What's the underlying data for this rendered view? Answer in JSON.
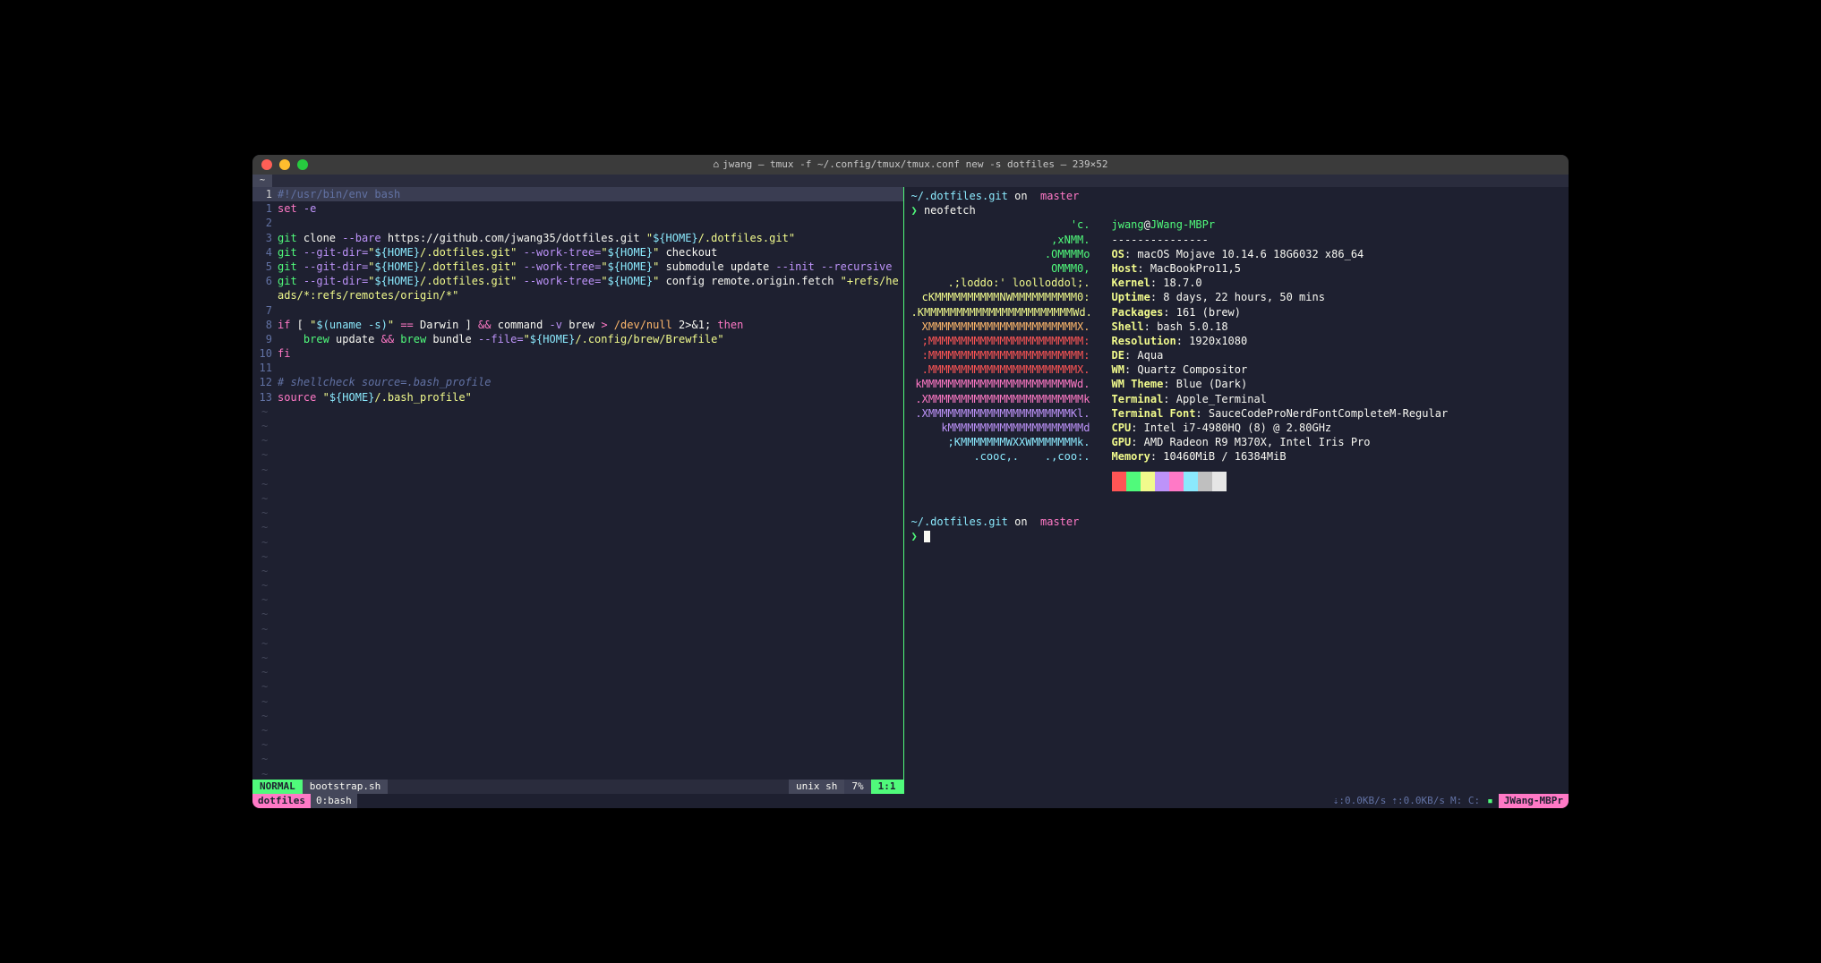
{
  "titlebar": {
    "title": "jwang — tmux -f ~/.config/tmux/tmux.conf new -s dotfiles — 239×52"
  },
  "tabbar": {
    "tab": "~"
  },
  "editor": {
    "filename": "bootstrap.sh",
    "mode": "NORMAL",
    "filetype_left": " unix",
    "filetype_right": " sh",
    "percent": "7%",
    "position": "1:1",
    "lines": {
      "l0_num": "1",
      "l0": "#!/usr/bin/env bash",
      "l1_num": "1",
      "l1_set": "set",
      "l1_flag": " -e",
      "l2_num": "2",
      "l3_num": "3",
      "l3_cmd": "git",
      "l3_rest1": " clone ",
      "l3_flag1": "--bare",
      "l3_url": " https://github.com/jwang35/dotfiles.git ",
      "l3_q": "\"",
      "l3_var": "${HOME}",
      "l3_path": "/.dotfiles.git",
      "l3_q2": "\"",
      "l4_num": "4",
      "l4_cmd": "git",
      "l4_sp": " ",
      "l4_flag1": "--git-dir=",
      "l4_q1": "\"",
      "l4_var1": "${HOME}",
      "l4_p1": "/.dotfiles.git",
      "l4_q2": "\"",
      "l4_sp2": " ",
      "l4_flag2": "--work-tree=",
      "l4_q3": "\"",
      "l4_var2": "${HOME}",
      "l4_q4": "\"",
      "l4_rest": " checkout",
      "l5_num": "5",
      "l5_cmd": "git",
      "l5_sp": " ",
      "l5_flag1": "--git-dir=",
      "l5_q1": "\"",
      "l5_var1": "${HOME}",
      "l5_p1": "/.dotfiles.git",
      "l5_q2": "\"",
      "l5_sp2": " ",
      "l5_flag2": "--work-tree=",
      "l5_q3": "\"",
      "l5_var2": "${HOME}",
      "l5_q4": "\"",
      "l5_rest": " submodule update ",
      "l5_flag3": "--init --recursive",
      "l6_num": "6",
      "l6_cmd": "git",
      "l6_sp": " ",
      "l6_flag1": "--git-dir=",
      "l6_q1": "\"",
      "l6_var1": "${HOME}",
      "l6_p1": "/.dotfiles.git",
      "l6_q2": "\"",
      "l6_sp2": " ",
      "l6_flag2": "--work-tree=",
      "l6_q3": "\"",
      "l6_var2": "${HOME}",
      "l6_q4": "\"",
      "l6_rest": " config remote.origin.fetch ",
      "l6_q5": "\"",
      "l6_str": "+refs/heads/*:refs/remotes/origin/*",
      "l6_q6": "\"",
      "l7_num": "7",
      "l8_num": "8",
      "l8_kw1": "if",
      "l8_br1": " [ ",
      "l8_q1": "\"",
      "l8_sub": "$(uname -s)",
      "l8_q2": "\"",
      "l8_eq": " == ",
      "l8_darwin": "Darwin",
      "l8_br2": " ] ",
      "l8_and": "&&",
      "l8_cmd": " command ",
      "l8_flag": "-v",
      "l8_brew": " brew ",
      "l8_op": "> ",
      "l8_dev": "/dev/null",
      "l8_redir": " 2>&1; ",
      "l8_then": "then",
      "l9_num": "9",
      "l9_indent": "    ",
      "l9_cmd1": "brew",
      "l9_up": " update ",
      "l9_and": "&&",
      "l9_cmd2": " brew",
      "l9_bundle": " bundle ",
      "l9_flag": "--file=",
      "l9_q1": "\"",
      "l9_var": "${HOME}",
      "l9_path": "/.config/brew/Brewfile",
      "l9_q2": "\"",
      "l10_num": "10",
      "l10_fi": "fi",
      "l11_num": "11",
      "l12_num": "12",
      "l12_comment": "# shellcheck source=.bash_profile",
      "l13_num": "13",
      "l13_cmd": "source",
      "l13_sp": " ",
      "l13_q1": "\"",
      "l13_var": "${HOME}",
      "l13_path": "/.bash_profile",
      "l13_q2": "\""
    },
    "tilde": "~"
  },
  "prompt": {
    "path": "~/.dotfiles.git",
    "on": " on ",
    "branch_icon": "",
    "branch": " master",
    "symbol": "❯",
    "command": " neofetch"
  },
  "neofetch": {
    "art": [
      "'c.",
      ",xNMM.",
      ".OMMMMo",
      "OMMM0,",
      ".;loddo:' loolloddol;.",
      "cKMMMMMMMMMMNWMMMMMMMMMM0:",
      ".KMMMMMMMMMMMMMMMMMMMMMMMWd.",
      "XMMMMMMMMMMMMMMMMMMMMMMMX.",
      ";MMMMMMMMMMMMMMMMMMMMMMMM:",
      ":MMMMMMMMMMMMMMMMMMMMMMMM:",
      ".MMMMMMMMMMMMMMMMMMMMMMMX.",
      "kMMMMMMMMMMMMMMMMMMMMMMMWd.",
      ".XMMMMMMMMMMMMMMMMMMMMMMMMk",
      ".XMMMMMMMMMMMMMMMMMMMMMMKl.",
      "kMMMMMMMMMMMMMMMMMMMMMd",
      ";KMMMMMMMWXXWMMMMMMMk.",
      ".cooc,.    .,coo:."
    ],
    "art_colors": [
      "#50fa7b",
      "#50fa7b",
      "#50fa7b",
      "#50fa7b",
      "#f1fa8c",
      "#f1fa8c",
      "#f1fa8c",
      "#ffb86c",
      "#ff5555",
      "#ff5555",
      "#ff5555",
      "#ff79c6",
      "#ff79c6",
      "#bd93f9",
      "#bd93f9",
      "#8be9fd",
      "#8be9fd"
    ],
    "user": "jwang",
    "at": "@",
    "host": "JWang-MBPr",
    "dashes": "---------------",
    "info": [
      {
        "k": "OS",
        "v": ": macOS Mojave 10.14.6 18G6032 x86_64"
      },
      {
        "k": "Host",
        "v": ": MacBookPro11,5"
      },
      {
        "k": "Kernel",
        "v": ": 18.7.0"
      },
      {
        "k": "Uptime",
        "v": ": 8 days, 22 hours, 50 mins"
      },
      {
        "k": "Packages",
        "v": ": 161 (brew)"
      },
      {
        "k": "Shell",
        "v": ": bash 5.0.18"
      },
      {
        "k": "Resolution",
        "v": ": 1920x1080"
      },
      {
        "k": "DE",
        "v": ": Aqua"
      },
      {
        "k": "WM",
        "v": ": Quartz Compositor"
      },
      {
        "k": "WM Theme",
        "v": ": Blue (Dark)"
      },
      {
        "k": "Terminal",
        "v": ": Apple_Terminal"
      },
      {
        "k": "Terminal Font",
        "v": ": SauceCodeProNerdFontCompleteM-Regular"
      },
      {
        "k": "CPU",
        "v": ": Intel i7-4980HQ (8) @ 2.80GHz"
      },
      {
        "k": "GPU",
        "v": ": AMD Radeon R9 M370X, Intel Iris Pro"
      },
      {
        "k": "Memory",
        "v": ": 10460MiB / 16384MiB"
      }
    ],
    "swatches": [
      "#ff5555",
      "#50fa7b",
      "#f1fa8c",
      "#bd93f9",
      "#ff79c6",
      "#8be9fd",
      "#bfbfbf",
      "#e6e6e6"
    ]
  },
  "tmux": {
    "session": "dotfiles",
    "window": "0:bash",
    "net_down": "⇣:0.0KB/s",
    "net_up": "⇡:0.0KB/s",
    "mc": "M:  C: ",
    "host": "JWang-MBPr"
  }
}
